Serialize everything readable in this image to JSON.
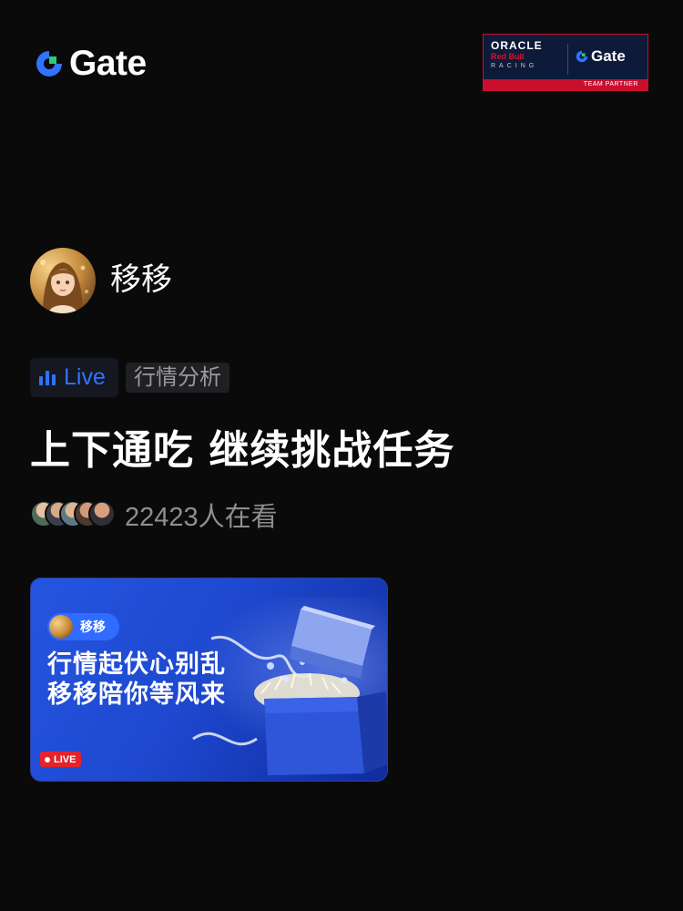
{
  "brand": {
    "logo_text": "Gate",
    "accent_color": "#2F73FF"
  },
  "partner_badge": {
    "line1": "ORACLE",
    "line2": "Red Bull",
    "line3": "RACING",
    "partner_logo_text": "Gate",
    "footer": "TEAM PARTNER"
  },
  "host": {
    "name": "移移"
  },
  "tags": {
    "live_label": "Live",
    "category": "行情分析"
  },
  "stream": {
    "title": "上下通吃  继续挑战任务",
    "viewer_count_text": "22423人在看"
  },
  "cover": {
    "host_name": "移移",
    "headline_line1": "行情起伏心别乱",
    "headline_line2": "移移陪你等风来",
    "live_badge": "LIVE"
  },
  "colors": {
    "background": "#0A0A0A",
    "live_badge_red": "#E5232B",
    "cover_blue": "#2555E0",
    "muted_text": "#8E8E8E"
  }
}
